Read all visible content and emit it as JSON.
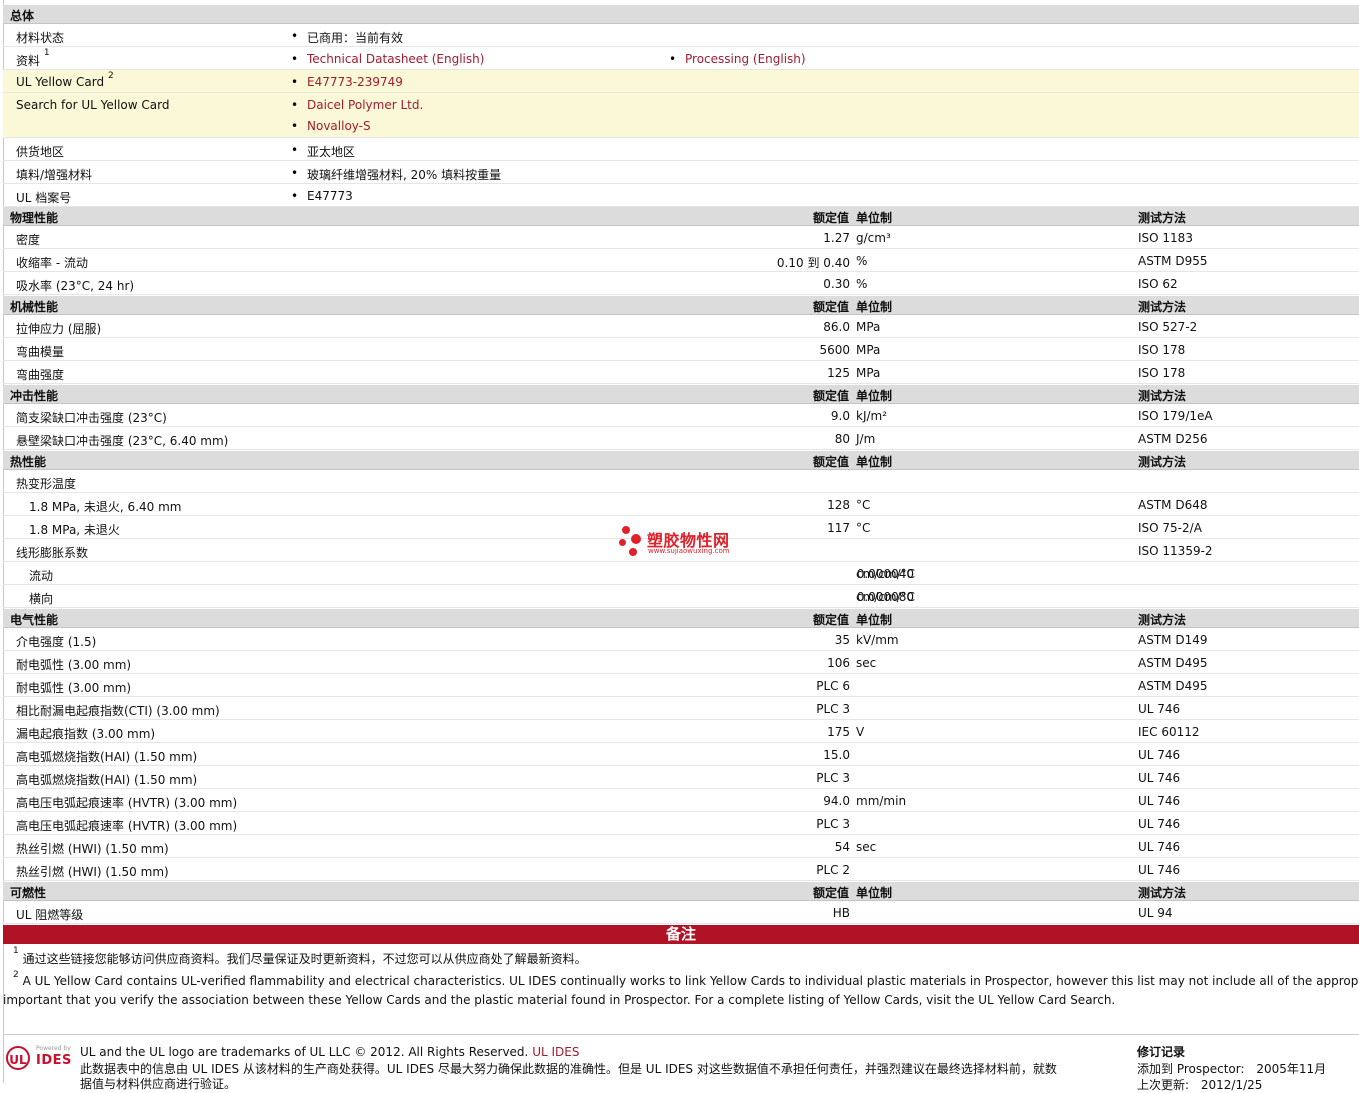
{
  "overview": {
    "title": "总体",
    "status_label": "材料状态",
    "status_value": "已商用：当前有效",
    "docs_label": "资料",
    "docs_sup": "1",
    "doc_links": [
      "Technical Datasheet (English)",
      "Processing (English)"
    ],
    "ul_card_label": "UL Yellow Card",
    "ul_card_sup": "2",
    "ul_card_value": "E47773-239749",
    "search_label": "Search for UL Yellow Card",
    "search_links": [
      "Daicel Polymer Ltd.",
      "Novalloy-S"
    ],
    "region_label": "供货地区",
    "region_value": "亚太地区",
    "filler_label": "填料/增强材料",
    "filler_value": "玻璃纤维增强材料, 20% 填料按重量",
    "ul_file_label": "UL 档案号",
    "ul_file_value": "E47773"
  },
  "headers": {
    "rated": "额定值",
    "unit": "单位制",
    "method": "测试方法"
  },
  "physical": {
    "title": "物理性能",
    "rows": [
      {
        "label": "密度",
        "value": "1.27",
        "unit": "g/cm³",
        "method": "ISO 1183"
      },
      {
        "label": "收缩率  - 流动",
        "value": "0.10 到  0.40",
        "unit": "%",
        "method": "ASTM D955"
      },
      {
        "label": "吸水率  (23°C, 24 hr)",
        "value": "0.30",
        "unit": "%",
        "method": "ISO 62"
      }
    ]
  },
  "mechanical": {
    "title": "机械性能",
    "rows": [
      {
        "label": "拉伸应力  (屈服)",
        "value": "86.0",
        "unit": "MPa",
        "method": "ISO 527-2"
      },
      {
        "label": "弯曲模量",
        "value": "5600",
        "unit": "MPa",
        "method": "ISO 178"
      },
      {
        "label": "弯曲强度",
        "value": "125",
        "unit": "MPa",
        "method": "ISO 178"
      }
    ]
  },
  "impact": {
    "title": "冲击性能",
    "rows": [
      {
        "label": "简支梁缺口冲击强度  (23°C)",
        "value": "9.0",
        "unit": "kJ/m²",
        "method": "ISO 179/1eA"
      },
      {
        "label": "悬壁梁缺口冲击强度  (23°C, 6.40 mm)",
        "value": "80",
        "unit": "J/m",
        "method": "ASTM D256"
      }
    ]
  },
  "thermal": {
    "title": "热性能",
    "hdt_label": "热变形温度",
    "hdt_rows": [
      {
        "label": "1.8 MPa, 未退火, 6.40 mm",
        "value": "128",
        "unit": "°C",
        "method": "ASTM D648"
      },
      {
        "label": "1.8 MPa, 未退火",
        "value": "117",
        "unit": "°C",
        "method": "ISO 75-2/A"
      }
    ],
    "clte_label": "线形膨胀系数",
    "clte_method": "ISO 11359-2",
    "clte_rows": [
      {
        "label": "流动",
        "value": "0.000040",
        "unit": "cm/cm/°C"
      },
      {
        "label": "横向",
        "value": "0.000080",
        "unit": "cm/cm/°C"
      }
    ]
  },
  "electrical": {
    "title": "电气性能",
    "rows": [
      {
        "label": "介电强度  (1.5)",
        "value": "35",
        "unit": "kV/mm",
        "method": "ASTM D149"
      },
      {
        "label": "耐电弧性  (3.00 mm)",
        "value": "106",
        "unit": "sec",
        "method": "ASTM D495"
      },
      {
        "label": "耐电弧性  (3.00 mm)",
        "value": "PLC 6",
        "unit": "",
        "method": "ASTM D495"
      },
      {
        "label": "相比耐漏电起痕指数(CTI) (3.00 mm)",
        "value": "PLC 3",
        "unit": "",
        "method": "UL 746"
      },
      {
        "label": "漏电起痕指数  (3.00 mm)",
        "value": "175",
        "unit": "V",
        "method": "IEC 60112"
      },
      {
        "label": "高电弧燃烧指数(HAI) (1.50 mm)",
        "value": "15.0",
        "unit": "",
        "method": "UL 746"
      },
      {
        "label": "高电弧燃烧指数(HAI) (1.50 mm)",
        "value": "PLC 3",
        "unit": "",
        "method": "UL 746"
      },
      {
        "label": "高电压电弧起痕速率  (HVTR) (3.00 mm)",
        "value": "94.0",
        "unit": "mm/min",
        "method": "UL 746"
      },
      {
        "label": "高电压电弧起痕速率  (HVTR) (3.00 mm)",
        "value": "PLC 3",
        "unit": "",
        "method": "UL 746"
      },
      {
        "label": "热丝引燃  (HWI) (1.50 mm)",
        "value": "54",
        "unit": "sec",
        "method": "UL 746"
      },
      {
        "label": "热丝引燃  (HWI) (1.50 mm)",
        "value": "PLC 2",
        "unit": "",
        "method": "UL 746"
      }
    ]
  },
  "flammability": {
    "title": "可燃性",
    "rows": [
      {
        "label": "UL 阻燃等级",
        "value": "HB",
        "unit": "",
        "method": "UL 94"
      }
    ]
  },
  "notes": {
    "title": "备注",
    "n1_sup": "1",
    "n1": "通过这些链接您能够访问供应商资料。我们尽量保证及时更新资料，不过您可以从供应商处了解最新资料。",
    "n2_sup": "2",
    "n2a": "A UL Yellow Card contains UL-verified flammability and electrical characteristics. UL IDES continually works to link Yellow Cards to individual plastic materials in Prospector, however this list may not include all of the appropriate link",
    "n2b": "important that you verify the association between these Yellow Cards and the plastic material found in Prospector. For a complete listing of Yellow Cards, visit the UL Yellow Card Search."
  },
  "footer": {
    "logo_powered": "Powered by",
    "logo_ul": "UL",
    "logo_ides": "IDES",
    "trademark": "UL and the UL logo are trademarks of UL LLC © 2012. All Rights Reserved.",
    "trademark_link": "UL IDES",
    "disclaimer": "此数据表中的信息由  UL IDES 从该材料的生产商处获得。UL IDES 尽最大努力确保此数据的准确性。但是  UL IDES 对这些数据值不承担任何责任，并强烈建议在最终选择材料前，就数",
    "disclaimer2": "据值与材料供应商进行验证。",
    "revision_title": "修订记录",
    "added_label": "添加到  Prospector:",
    "added_value": "2005年11月",
    "updated_label": "上次更新:",
    "updated_value": "2012/1/25"
  },
  "watermark": {
    "text": "塑胶物性网",
    "url": "www.sujiaowuxing.com"
  }
}
